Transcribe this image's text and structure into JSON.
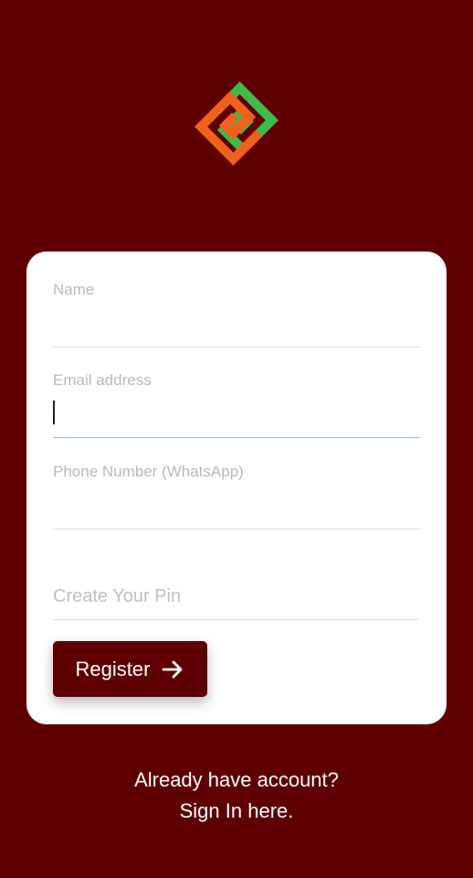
{
  "app": {
    "logo_icon": "interlocked-square-logo-icon",
    "colors": {
      "background": "#5e0001",
      "logo_green": "#3cba4a",
      "logo_orange": "#f3601b",
      "card": "#ffffff"
    }
  },
  "form": {
    "name": {
      "label": "Name",
      "value": ""
    },
    "email": {
      "label": "Email address",
      "value": ""
    },
    "phone": {
      "label": "Phone Number (WhatsApp)",
      "value": ""
    },
    "pin": {
      "placeholder": "Create Your Pin",
      "value": ""
    },
    "register_button": {
      "label": "Register",
      "icon": "arrow-right-icon"
    }
  },
  "footer": {
    "question": "Already have account?",
    "signin_link": "Sign In here."
  }
}
